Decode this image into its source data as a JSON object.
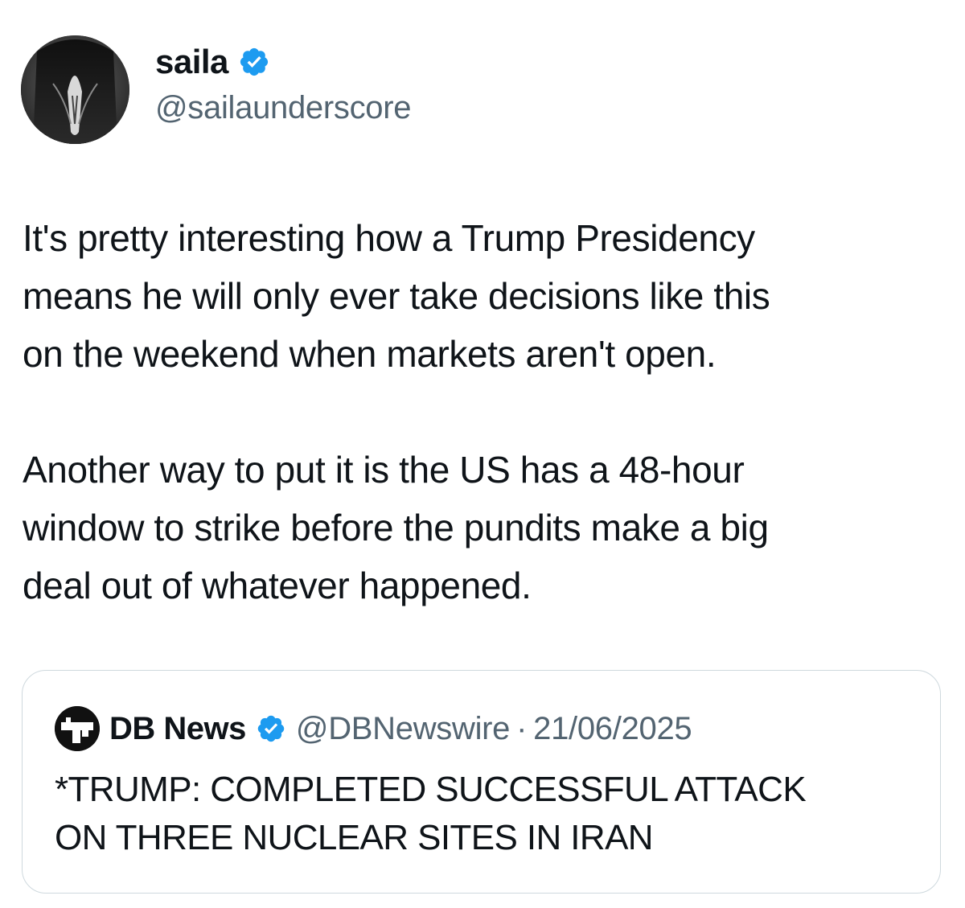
{
  "author": {
    "display_name": "saila",
    "handle": "@sailaunderscore",
    "verified": true,
    "avatar_icon": "penguin-photo-avatar"
  },
  "tweet": {
    "paragraphs": [
      "It's pretty interesting how a Trump Presidency\nmeans he will only ever take decisions like this\non the weekend when markets aren't open.",
      "Another way to put it is the US has a 48-hour\nwindow to strike before the pundits make a big\ndeal out of whatever happened."
    ]
  },
  "quoted_tweet": {
    "display_name": "DB News",
    "handle": "@DBNewswire",
    "separator": "·",
    "date": "21/06/2025",
    "verified": true,
    "avatar_icon": "db-news-logo-avatar",
    "text": "*TRUMP: COMPLETED SUCCESSFUL ATTACK\nON THREE NUCLEAR SITES IN IRAN"
  },
  "colors": {
    "verified_badge": "#1d9bf0",
    "secondary_text": "#536471",
    "primary_text": "#0f1419",
    "card_border": "#cfd9de"
  }
}
